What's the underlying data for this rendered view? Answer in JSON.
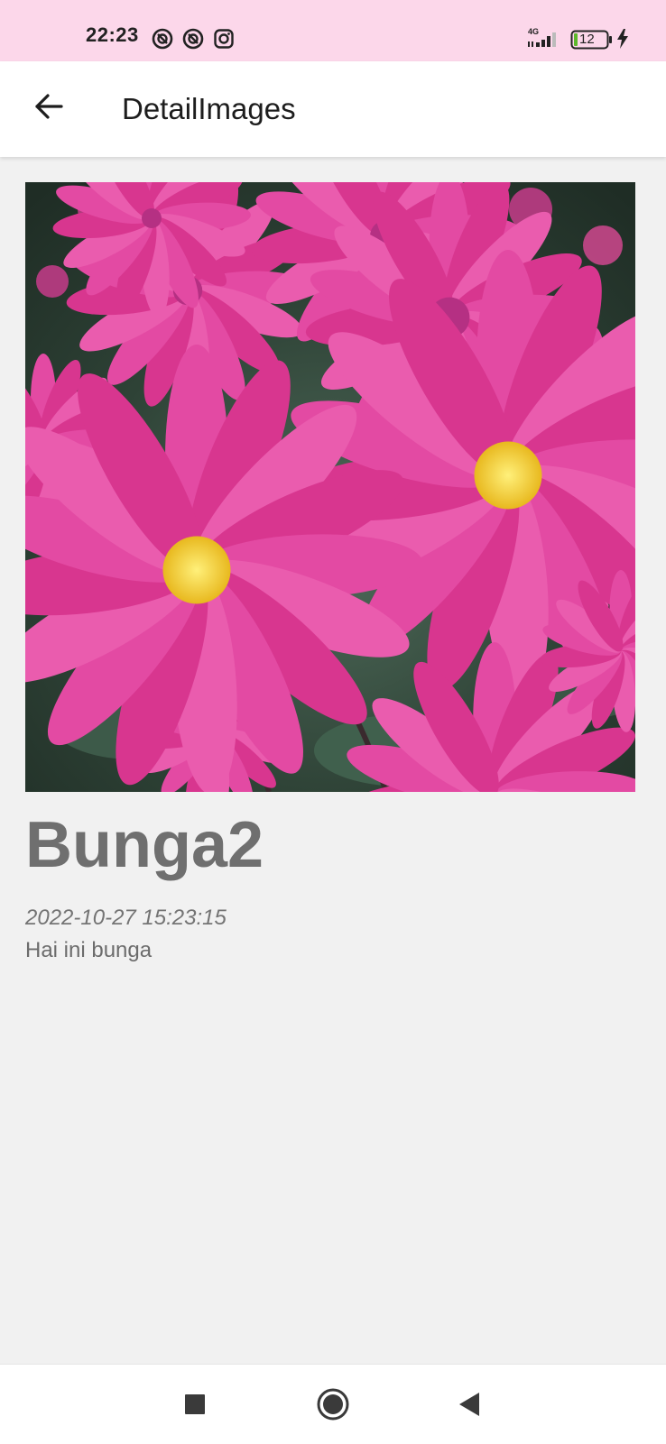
{
  "status_bar": {
    "time": "22:23",
    "network": "4G",
    "battery": "12",
    "icons": [
      "notification-icon",
      "notification-icon",
      "instagram-icon",
      "signal-icon",
      "battery-icon",
      "charging-icon"
    ]
  },
  "app_bar": {
    "title": "DetailImages",
    "back_icon": "arrow-left-icon"
  },
  "detail": {
    "title": "Bunga2",
    "date": "2022-10-27 15:23:15",
    "description": "Hai ini bunga"
  },
  "nav_bar": {
    "icons": [
      "recent-apps-icon",
      "home-icon",
      "back-icon"
    ]
  },
  "colors": {
    "status_bar_bg": "#fcd7ea",
    "app_bar_bg": "#ffffff",
    "page_bg": "#f1f1f1",
    "flower_pink": "#e0449e",
    "flower_center": "#f5d33b"
  }
}
